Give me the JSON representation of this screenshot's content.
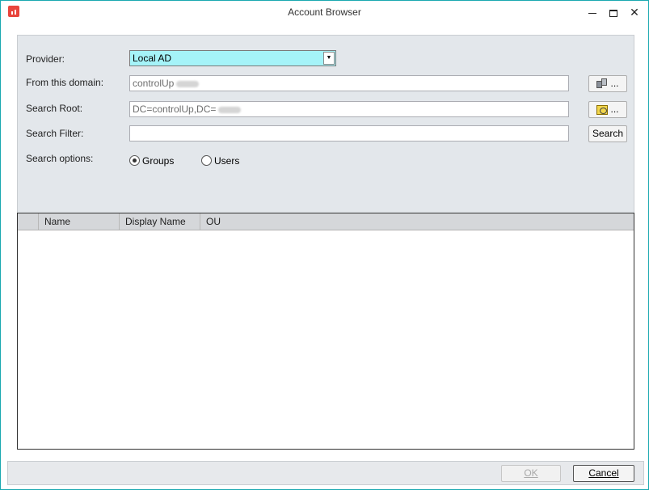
{
  "window": {
    "title": "Account Browser",
    "minimize_glyph": "—",
    "close_glyph": "✕"
  },
  "form": {
    "provider_label": "Provider:",
    "provider_value": "Local AD",
    "provider_arrow": "▼",
    "domain_label": "From this domain:",
    "domain_value": "controlUp",
    "search_root_label": "Search Root:",
    "search_root_value": "DC=controlUp,DC=",
    "search_filter_label": "Search Filter:",
    "search_filter_value": "",
    "search_button": "Search",
    "browse_dots": "...",
    "search_options_label": "Search options:",
    "options": [
      {
        "label": "Groups",
        "selected": true
      },
      {
        "label": "Users",
        "selected": false
      }
    ]
  },
  "grid": {
    "columns": [
      "Name",
      "Display Name",
      "OU"
    ]
  },
  "footer": {
    "ok_label": "OK",
    "cancel_label": "Cancel"
  },
  "colors": {
    "provider_bg": "#a5f3f8",
    "panel_bg": "#e3e7eb",
    "window_border": "#1aa8b0"
  }
}
